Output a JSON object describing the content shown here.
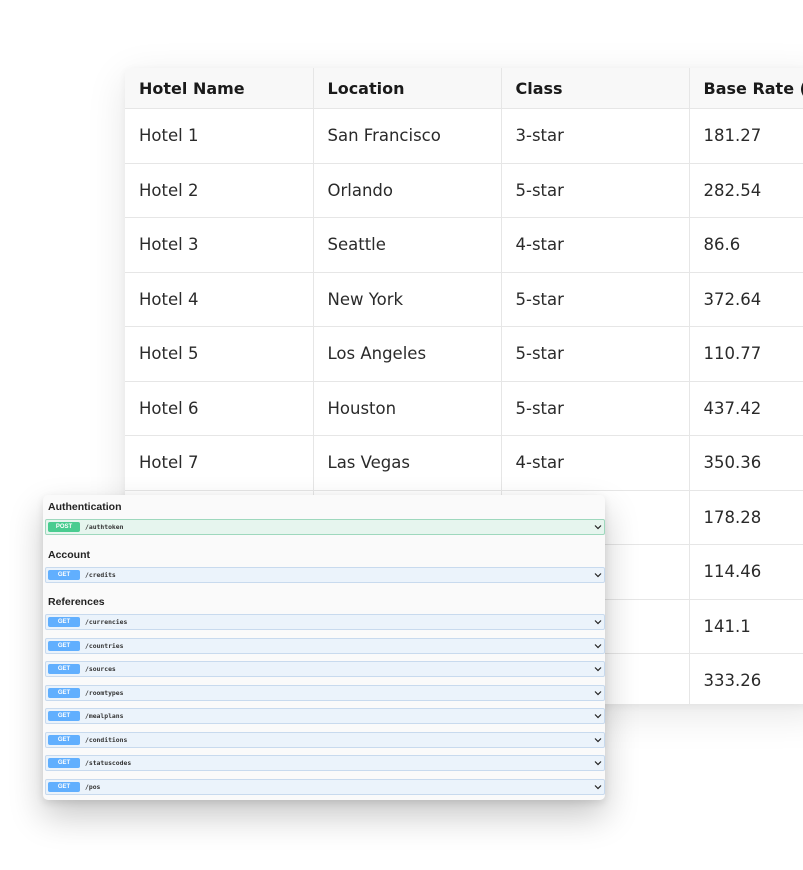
{
  "hotel_table": {
    "headers": [
      "Hotel Name",
      "Location",
      "Class",
      "Base Rate (U"
    ],
    "rows": [
      [
        "Hotel 1",
        "San Francisco",
        "3-star",
        "181.27"
      ],
      [
        "Hotel 2",
        "Orlando",
        "5-star",
        "282.54"
      ],
      [
        "Hotel 3",
        "Seattle",
        "4-star",
        "86.6"
      ],
      [
        "Hotel 4",
        "New York",
        "5-star",
        "372.64"
      ],
      [
        "Hotel 5",
        "Los Angeles",
        "5-star",
        "110.77"
      ],
      [
        "Hotel 6",
        "Houston",
        "5-star",
        "437.42"
      ],
      [
        "Hotel 7",
        "Las Vegas",
        "4-star",
        "350.36"
      ],
      [
        "",
        "",
        "",
        "178.28"
      ],
      [
        "",
        "",
        "",
        "114.46"
      ],
      [
        "",
        "",
        "",
        "141.1"
      ],
      [
        "",
        "",
        "",
        "333.26"
      ]
    ]
  },
  "api_panel": {
    "sections": [
      {
        "title": "Authentication",
        "operations": [
          {
            "method": "POST",
            "path": "/authtoken"
          }
        ]
      },
      {
        "title": "Account",
        "operations": [
          {
            "method": "GET",
            "path": "/credits"
          }
        ]
      },
      {
        "title": "References",
        "operations": [
          {
            "method": "GET",
            "path": "/currencies"
          },
          {
            "method": "GET",
            "path": "/countries"
          },
          {
            "method": "GET",
            "path": "/sources"
          },
          {
            "method": "GET",
            "path": "/roomtypes"
          },
          {
            "method": "GET",
            "path": "/mealplans"
          },
          {
            "method": "GET",
            "path": "/conditions"
          },
          {
            "method": "GET",
            "path": "/statuscodes"
          },
          {
            "method": "GET",
            "path": "/pos"
          }
        ]
      }
    ]
  },
  "colors": {
    "get_badge": "#61affe",
    "post_badge": "#49cc90",
    "get_row_bg": "#ebf3fb",
    "post_row_bg": "#e6f5ee"
  },
  "icons": {
    "operation_toggle": "chevron-down-icon"
  }
}
